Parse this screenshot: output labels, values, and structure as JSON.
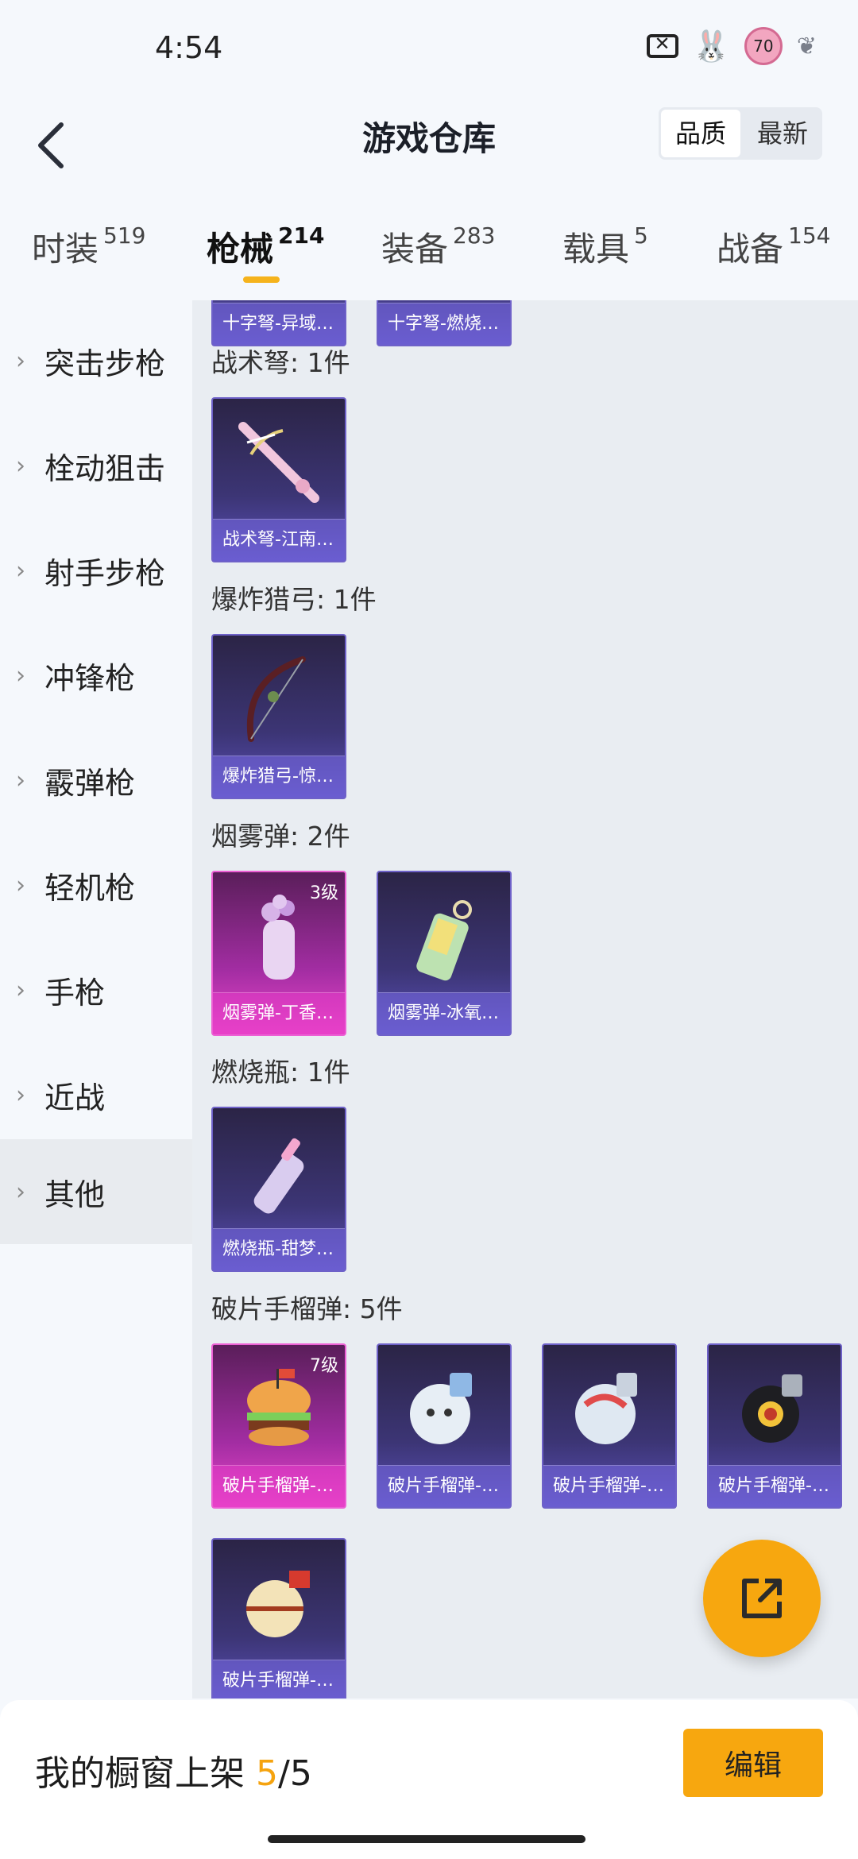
{
  "status": {
    "time": "4:54",
    "badge": "70"
  },
  "header": {
    "title": "游戏仓库",
    "sort": [
      "品质",
      "最新"
    ]
  },
  "tabs": [
    {
      "label": "时装",
      "count": "519"
    },
    {
      "label": "枪械",
      "count": "214"
    },
    {
      "label": "装备",
      "count": "283"
    },
    {
      "label": "载具",
      "count": "5"
    },
    {
      "label": "战备",
      "count": "154"
    }
  ],
  "sidebar": [
    {
      "label": "突击步枪"
    },
    {
      "label": "栓动狙击"
    },
    {
      "label": "射手步枪"
    },
    {
      "label": "冲锋枪"
    },
    {
      "label": "霰弹枪"
    },
    {
      "label": "轻机枪"
    },
    {
      "label": "手枪"
    },
    {
      "label": "近战"
    },
    {
      "label": "其他"
    }
  ],
  "sections": [
    {
      "title": "",
      "items": [
        {
          "name": "十字弩-异域…"
        },
        {
          "name": "十字弩-燃烧…"
        }
      ]
    },
    {
      "title": "战术弩: 1件",
      "items": [
        {
          "name": "战术弩-江南…",
          "art": "crossbow"
        }
      ]
    },
    {
      "title": "爆炸猎弓: 1件",
      "items": [
        {
          "name": "爆炸猎弓-惊…",
          "art": "bow"
        }
      ]
    },
    {
      "title": "烟雾弹: 2件",
      "items": [
        {
          "name": "烟雾弹-丁香…",
          "level": "3级",
          "art": "smoke-pink"
        },
        {
          "name": "烟雾弹-冰氧…",
          "art": "smoke-green"
        }
      ]
    },
    {
      "title": "燃烧瓶: 1件",
      "items": [
        {
          "name": "燃烧瓶-甜梦…",
          "art": "bottle"
        }
      ]
    },
    {
      "title": "破片手榴弹: 5件",
      "items": [
        {
          "name": "破片手榴弹-…",
          "level": "7级",
          "art": "burger"
        },
        {
          "name": "破片手榴弹-…",
          "art": "grenade-white"
        },
        {
          "name": "破片手榴弹-…",
          "art": "grenade-red"
        },
        {
          "name": "破片手榴弹-…",
          "art": "grenade-eye"
        },
        {
          "name": "破片手榴弹-…",
          "art": "grenade-ball"
        }
      ]
    }
  ],
  "bottom_bar": {
    "text": "我的橱窗上架",
    "count_current": "5",
    "count_sep": "/",
    "count_total": "5",
    "edit_label": "编辑"
  },
  "colors": {
    "accent": "#f7a70f",
    "card_purple": "#3c3575",
    "card_pink": "#a22da2"
  }
}
